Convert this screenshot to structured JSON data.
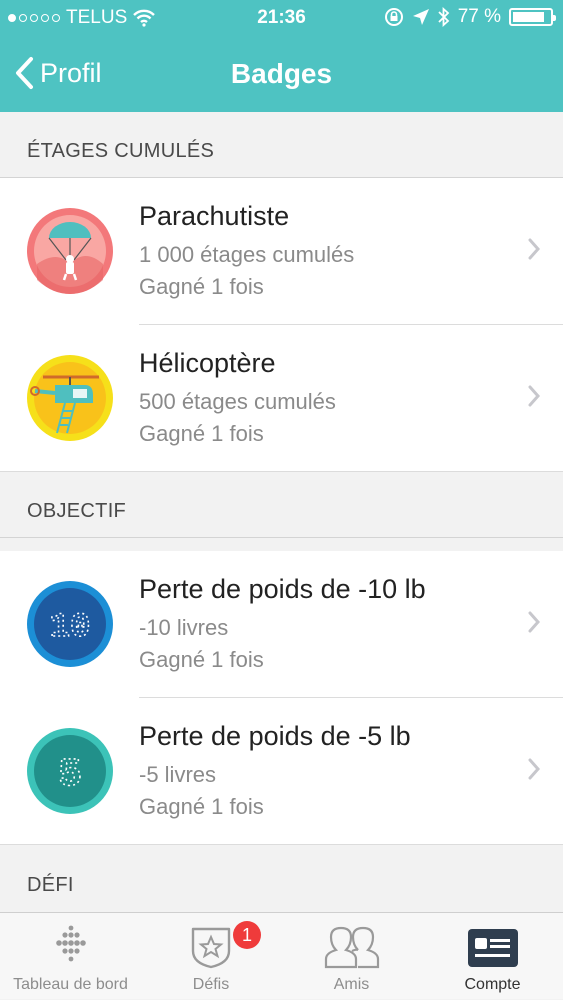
{
  "status_bar": {
    "carrier": "TELUS",
    "time": "21:36",
    "battery": "77 %",
    "battery_level": 0.77
  },
  "nav": {
    "back_label": "Profil",
    "title": "Badges"
  },
  "sections": [
    {
      "header": "ÉTAGES CUMULÉS",
      "items": [
        {
          "title": "Parachutiste",
          "subtitle": "1 000 étages cumulés",
          "earned": "Gagné 1 fois",
          "icon": "parachute-badge-icon"
        },
        {
          "title": "Hélicoptère",
          "subtitle": "500 étages cumulés",
          "earned": "Gagné 1 fois",
          "icon": "helicopter-badge-icon"
        }
      ]
    },
    {
      "header": "OBJECTIF",
      "items": [
        {
          "title": "Perte de poids de -10 lb",
          "subtitle": "-10 livres",
          "earned": "Gagné 1 fois",
          "icon": "weight-loss-10-badge-icon",
          "badge_text": "10"
        },
        {
          "title": "Perte de poids de -5 lb",
          "subtitle": "-5 livres",
          "earned": "Gagné 1 fois",
          "icon": "weight-loss-5-badge-icon",
          "badge_text": "5"
        }
      ]
    },
    {
      "header": "DÉFI",
      "items": []
    }
  ],
  "tabbar": {
    "tabs": [
      {
        "label": "Tableau de bord",
        "icon": "dashboard-dots-icon",
        "active": false
      },
      {
        "label": "Défis",
        "icon": "star-shield-icon",
        "active": false,
        "badge": "1"
      },
      {
        "label": "Amis",
        "icon": "friends-icon",
        "active": false
      },
      {
        "label": "Compte",
        "icon": "account-card-icon",
        "active": true
      }
    ]
  },
  "colors": {
    "header": "#4ec3c2",
    "notification": "#ef3b3b"
  }
}
